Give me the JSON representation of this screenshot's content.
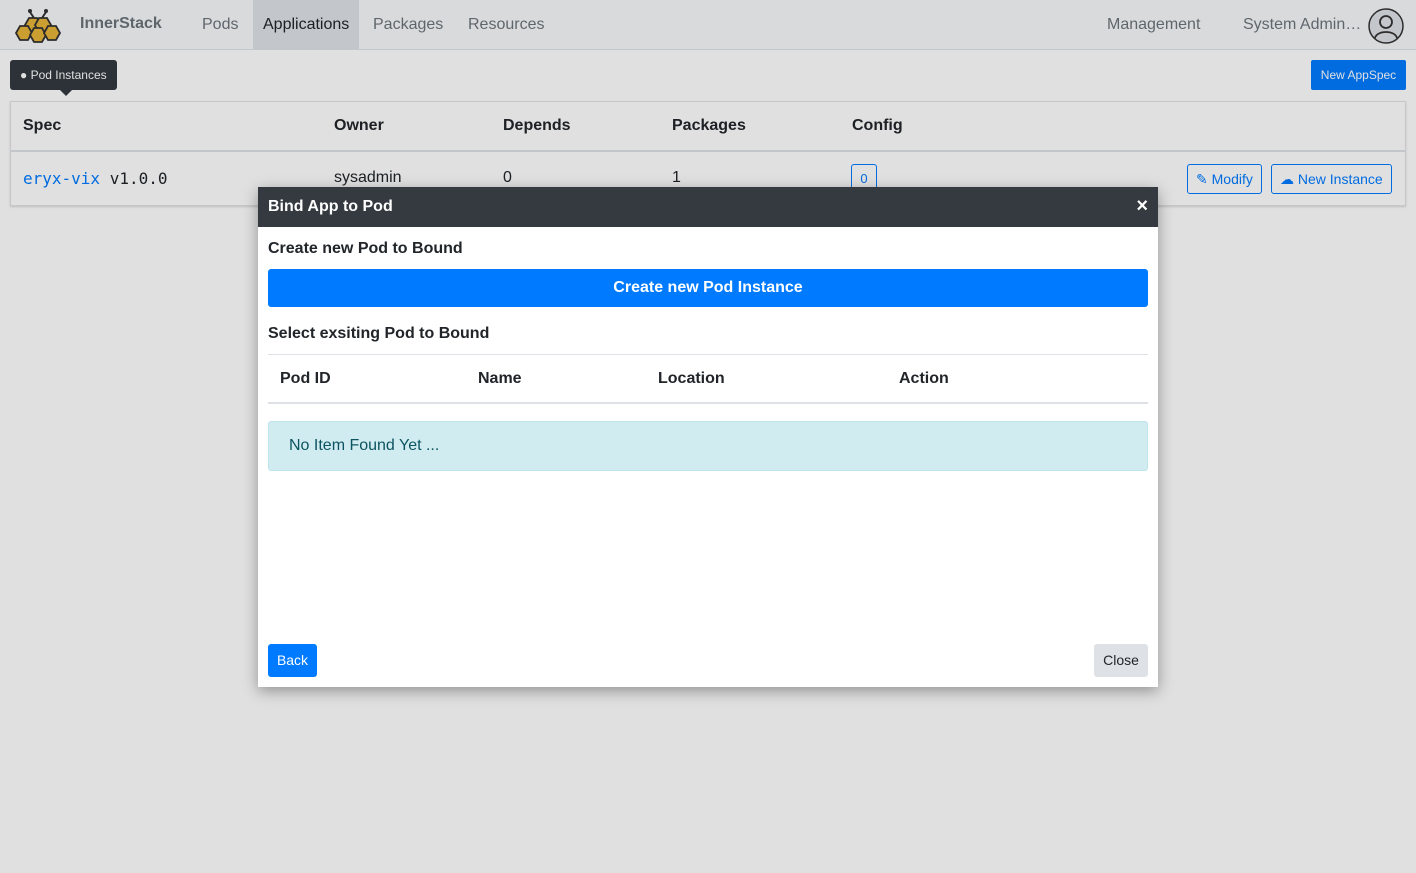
{
  "navbar": {
    "brand": "InnerStack",
    "items": [
      {
        "label": "Pods"
      },
      {
        "label": "Applications"
      },
      {
        "label": "Packages"
      },
      {
        "label": "Resources"
      }
    ],
    "management": "Management",
    "user": "System Admin…"
  },
  "toolbar": {
    "pod_instances": "Pod Instances",
    "new_appspec": "New AppSpec"
  },
  "table": {
    "headers": [
      "Spec",
      "Owner",
      "Depends",
      "Packages",
      "Config"
    ],
    "row": {
      "spec_name": "eryx-vix",
      "spec_version": "v1.0.0",
      "owner": "sysadmin",
      "depends": "0",
      "packages": "1",
      "config": "0",
      "modify": "Modify",
      "new_instance": "New Instance"
    }
  },
  "modal": {
    "title": "Bind App to Pod",
    "close_symbol": "×",
    "create_section": "Create new Pod to Bound",
    "create_button": "Create new Pod Instance",
    "select_section": "Select exsiting Pod to Bound",
    "columns": [
      "Pod ID",
      "Name",
      "Location",
      "Action"
    ],
    "empty": "No Item Found Yet ...",
    "back": "Back",
    "close": "Close"
  },
  "colors": {
    "primary": "#007bff",
    "dark": "#343a40",
    "info_bg": "#d1ecf1"
  }
}
